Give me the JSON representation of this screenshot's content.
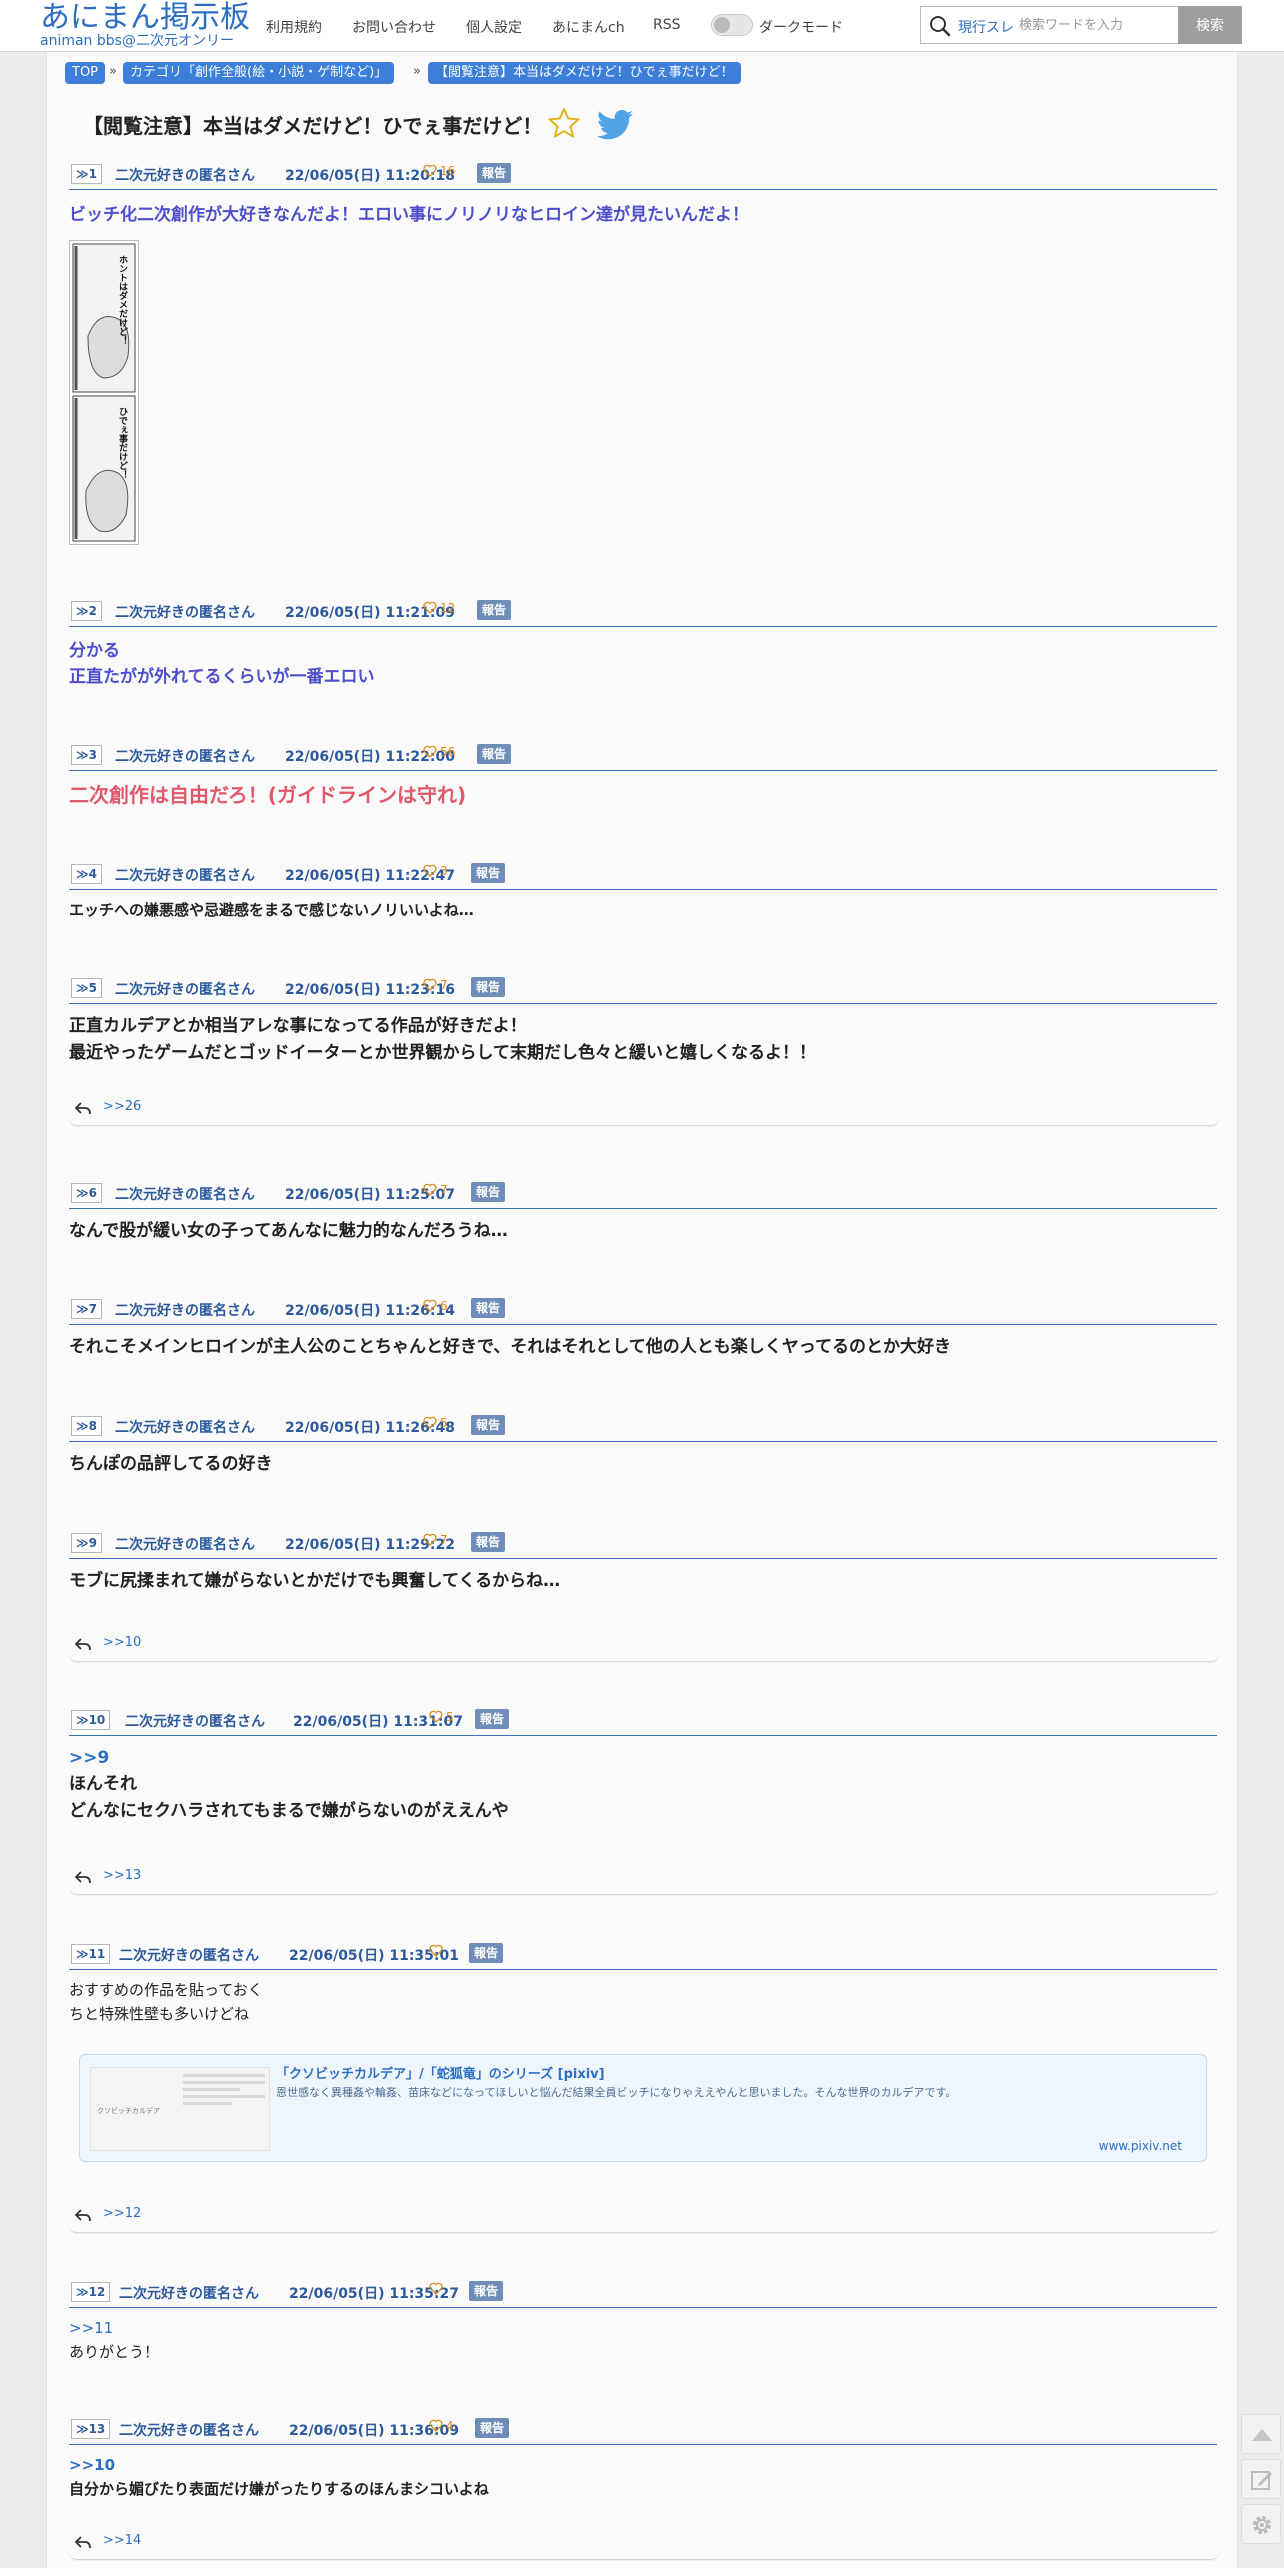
{
  "header": {
    "logo_title": "あにまん掲示板",
    "logo_sub": "animan bbs@二次元オンリー",
    "nav": [
      "利用規約",
      "お問い合わせ",
      "個人設定",
      "あにまんch",
      "RSS"
    ],
    "dark_mode_label": "ダークモード",
    "search_scope": "現行スレ",
    "search_placeholder": "検索ワードを入力",
    "search_button": "検索"
  },
  "breadcrumb": [
    "TOP",
    "カテゴリ「創作全般(絵・小説・ゲ制など)」",
    "【閲覧注意】本当はダメだけど！ひでぇ事だけど！"
  ],
  "breadcrumb_sep": "»",
  "thread_title": "【閲覧注意】本当はダメだけど！ひでぇ事だけど！",
  "report_label": "報告",
  "posts": [
    {
      "num": "≫1",
      "name": "二次元好きの匿名さん",
      "date": "22/06/05(日) 11:20:18",
      "likes": "16",
      "lines": [
        "ビッチ化二次創作が大好きなんだよ！エロい事にノリノリなヒロイン達が見たいんだよ！"
      ],
      "replies": ""
    },
    {
      "num": "≫2",
      "name": "二次元好きの匿名さん",
      "date": "22/06/05(日) 11:21:09",
      "likes": "12",
      "lines": [
        "分かる",
        "正直たがが外れてるくらいが一番エロい"
      ],
      "replies": ""
    },
    {
      "num": "≫3",
      "name": "二次元好きの匿名さん",
      "date": "22/06/05(日) 11:22:00",
      "likes": "56",
      "lines": [
        "二次創作は自由だろ！(ガイドラインは守れ)"
      ],
      "replies": ""
    },
    {
      "num": "≫4",
      "name": "二次元好きの匿名さん",
      "date": "22/06/05(日) 11:22:47",
      "likes": "3",
      "lines": [
        "エッチへの嫌悪感や忌避感をまるで感じないノリいいよね…"
      ],
      "replies": ""
    },
    {
      "num": "≫5",
      "name": "二次元好きの匿名さん",
      "date": "22/06/05(日) 11:23:16",
      "likes": "7",
      "lines": [
        "正直カルデアとか相当アレな事になってる作品が好きだよ！",
        "最近やったゲームだとゴッドイーターとか世界観からして末期だし色々と緩いと嬉しくなるよ！！"
      ],
      "replies": ">>26"
    },
    {
      "num": "≫6",
      "name": "二次元好きの匿名さん",
      "date": "22/06/05(日) 11:25:07",
      "likes": "7",
      "lines": [
        "なんで股が緩い女の子ってあんなに魅力的なんだろうね…"
      ],
      "replies": ""
    },
    {
      "num": "≫7",
      "name": "二次元好きの匿名さん",
      "date": "22/06/05(日) 11:26:14",
      "likes": "6",
      "lines": [
        "それこそメインヒロインが主人公のことちゃんと好きで、それはそれとして他の人とも楽しくヤってるのとか大好き"
      ],
      "replies": ""
    },
    {
      "num": "≫8",
      "name": "二次元好きの匿名さん",
      "date": "22/06/05(日) 11:26:48",
      "likes": "5",
      "lines": [
        "ちんぽの品評してるの好き"
      ],
      "replies": ""
    },
    {
      "num": "≫9",
      "name": "二次元好きの匿名さん",
      "date": "22/06/05(日) 11:29:22",
      "likes": "7",
      "lines": [
        "モブに尻揉まれて嫌がらないとかだけでも興奮してくるからね…"
      ],
      "replies": ">>10"
    },
    {
      "num": "≫10",
      "name": "二次元好きの匿名さん",
      "date": "22/06/05(日) 11:31:07",
      "likes": "5",
      "anchor": ">>9",
      "lines": [
        "ほんそれ",
        "どんなにセクハラされてもまるで嫌がらないのがええんや"
      ],
      "replies": ">>13"
    },
    {
      "num": "≫11",
      "name": "二次元好きの匿名さん",
      "date": "22/06/05(日) 11:35:01",
      "likes": "",
      "lines": [
        "おすすめの作品を貼っておく",
        "ちと特殊性壁も多いけどね"
      ],
      "replies": ">>12"
    },
    {
      "num": "≫12",
      "name": "二次元好きの匿名さん",
      "date": "22/06/05(日) 11:35:27",
      "likes": "",
      "anchor": ">>11",
      "lines": [
        "ありがとう！"
      ],
      "replies": ""
    },
    {
      "num": "≫13",
      "name": "二次元好きの匿名さん",
      "date": "22/06/05(日) 11:36:09",
      "likes": "4",
      "anchor": ">>10",
      "lines": [
        "自分から媚びたり表面だけ嫌がったりするのほんまシコいよね"
      ],
      "replies": ">>14"
    }
  ],
  "manga": {
    "caption_1": "ホントはダメだけど！",
    "caption_2": "ひでぇ事だけど！"
  },
  "link_card": {
    "title": "「クソビッチカルデア」/「蛇狐竜」のシリーズ [pixiv]",
    "desc": "恩世感なく異種姦や輪姦、苗床などになってほしいと悩んだ結果全員ビッチになりゃええやんと思いました。そんな世界のカルデアです。",
    "url": "www.pixiv.net",
    "thumb_label": "クソビッチカルデア"
  },
  "colors": {
    "accent": "#2c6fc1",
    "report": "#6f8db9",
    "like": "#d78a1c",
    "purple": "#4d4ecb",
    "red": "#e0596a"
  }
}
